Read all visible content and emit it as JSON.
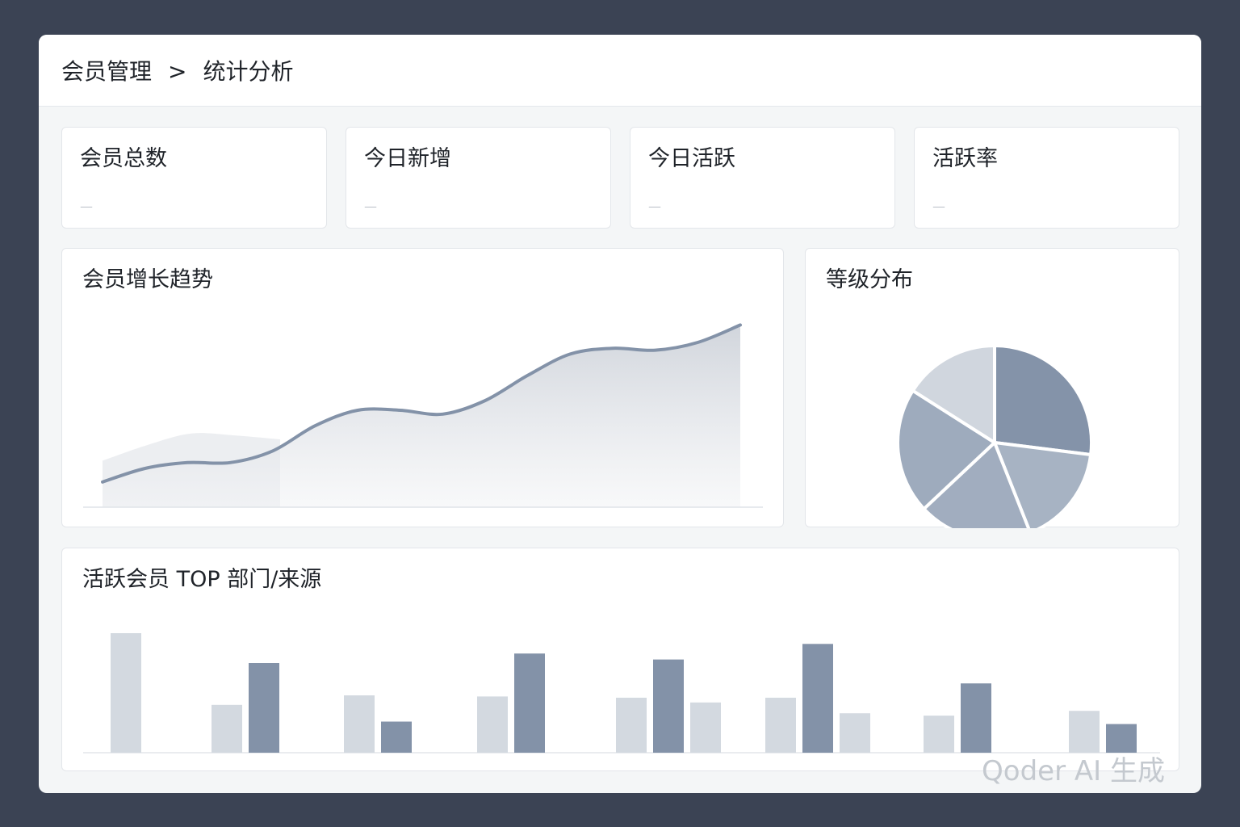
{
  "breadcrumb": {
    "parent": "会员管理",
    "separator": ">",
    "current": "统计分析"
  },
  "stats": [
    {
      "label": "会员总数",
      "value": "—"
    },
    {
      "label": "今日新增",
      "value": "—"
    },
    {
      "label": "今日活跃",
      "value": "—"
    },
    {
      "label": "活跃率",
      "value": "—"
    }
  ],
  "growth_panel": {
    "title": "会员增长趋势"
  },
  "level_panel": {
    "title": "等级分布"
  },
  "top_panel": {
    "title": "活跃会员 TOP 部门/来源"
  },
  "watermark": "Qoder AI 生成",
  "colors": {
    "page_background": "#3b4354",
    "window_background": "#f4f6f7",
    "card_background": "#ffffff",
    "series_dark": "#8392a8",
    "series_light": "#d3d9e0",
    "pie_slices": [
      "#8493a9",
      "#a7b3c3",
      "#a1adbf",
      "#9eabbd",
      "#d0d6de"
    ]
  },
  "chart_data": [
    {
      "type": "area",
      "title": "会员增长趋势",
      "xlabel": "",
      "ylabel": "",
      "ylim": [
        0,
        100
      ],
      "grid": false,
      "series": [
        {
          "values": [
            13,
            20,
            23,
            23,
            29,
            42,
            50,
            50,
            48,
            55,
            68,
            79,
            82,
            81,
            85,
            94
          ]
        },
        {
          "values": [
            24,
            32,
            38,
            37,
            35
          ]
        }
      ]
    },
    {
      "type": "pie",
      "title": "等级分布",
      "values": [
        27,
        17,
        19,
        21,
        16
      ],
      "legend": "none"
    },
    {
      "type": "bar",
      "title": "活跃会员 TOP 部门/来源",
      "ylim": [
        0,
        100
      ],
      "grid": false,
      "groups": [
        [
          {
            "v": 100,
            "s": "light"
          }
        ],
        [
          {
            "v": 40,
            "s": "light"
          },
          {
            "v": 75,
            "s": "dark"
          }
        ],
        [
          {
            "v": 48,
            "s": "light"
          },
          {
            "v": 26,
            "s": "dark"
          }
        ],
        [
          {
            "v": 47,
            "s": "light"
          },
          {
            "v": 83,
            "s": "dark"
          }
        ],
        [
          {
            "v": 46,
            "s": "light"
          },
          {
            "v": 78,
            "s": "dark"
          },
          {
            "v": 42,
            "s": "light"
          }
        ],
        [
          {
            "v": 46,
            "s": "light"
          },
          {
            "v": 91,
            "s": "dark"
          },
          {
            "v": 33,
            "s": "light"
          }
        ],
        [
          {
            "v": 31,
            "s": "light"
          },
          {
            "v": 58,
            "s": "dark"
          }
        ],
        [
          {
            "v": 35,
            "s": "light"
          },
          {
            "v": 24,
            "s": "dark"
          }
        ]
      ]
    }
  ]
}
